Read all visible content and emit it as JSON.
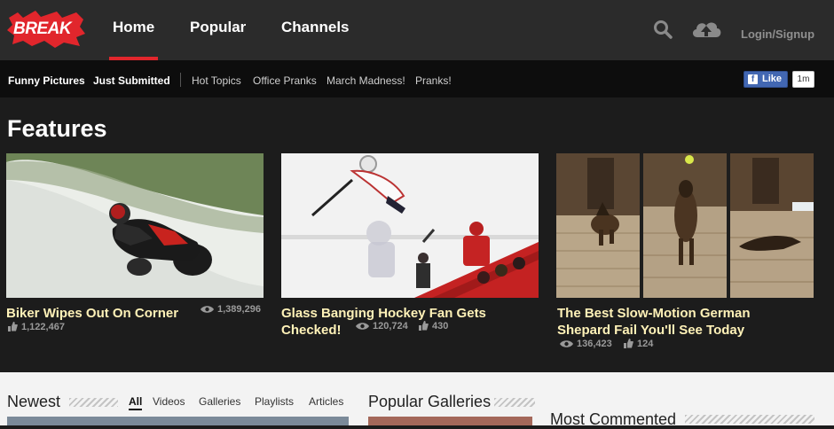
{
  "brand": {
    "logo_text": "BREAK",
    "accent": "#e1262c"
  },
  "topnav": {
    "items": [
      {
        "label": "Home"
      },
      {
        "label": "Popular"
      },
      {
        "label": "Channels"
      }
    ],
    "login_label": "Login/Signup",
    "icons": [
      "search-icon",
      "upload-cloud-icon"
    ]
  },
  "subnav": {
    "strong_items": [
      {
        "label": "Funny Pictures"
      },
      {
        "label": "Just Submitted"
      }
    ],
    "items": [
      {
        "label": "Hot Topics"
      },
      {
        "label": "Office Pranks"
      },
      {
        "label": "March Madness!"
      },
      {
        "label": "Pranks!"
      }
    ],
    "fb_like_label": "Like",
    "fb_like_count": "1m"
  },
  "features": {
    "title": "Features",
    "cards": [
      {
        "title": "Biker Wipes Out On Corner",
        "views": "1,389,296",
        "likes": "1,122,467"
      },
      {
        "title_line1": "Glass Banging Hockey Fan Gets",
        "title_line2": "Checked!",
        "views": "120,724",
        "likes": "430"
      },
      {
        "title_line1": "The Best Slow-Motion German",
        "title_line2": "Shepard Fail You'll See Today",
        "views": "136,423",
        "likes": "124"
      }
    ]
  },
  "lower": {
    "newest_title": "Newest",
    "tabs": [
      {
        "label": "All"
      },
      {
        "label": "Videos"
      },
      {
        "label": "Galleries"
      },
      {
        "label": "Playlists"
      },
      {
        "label": "Articles"
      }
    ],
    "popular_galleries_title": "Popular Galleries",
    "most_commented_title": "Most Commented"
  }
}
